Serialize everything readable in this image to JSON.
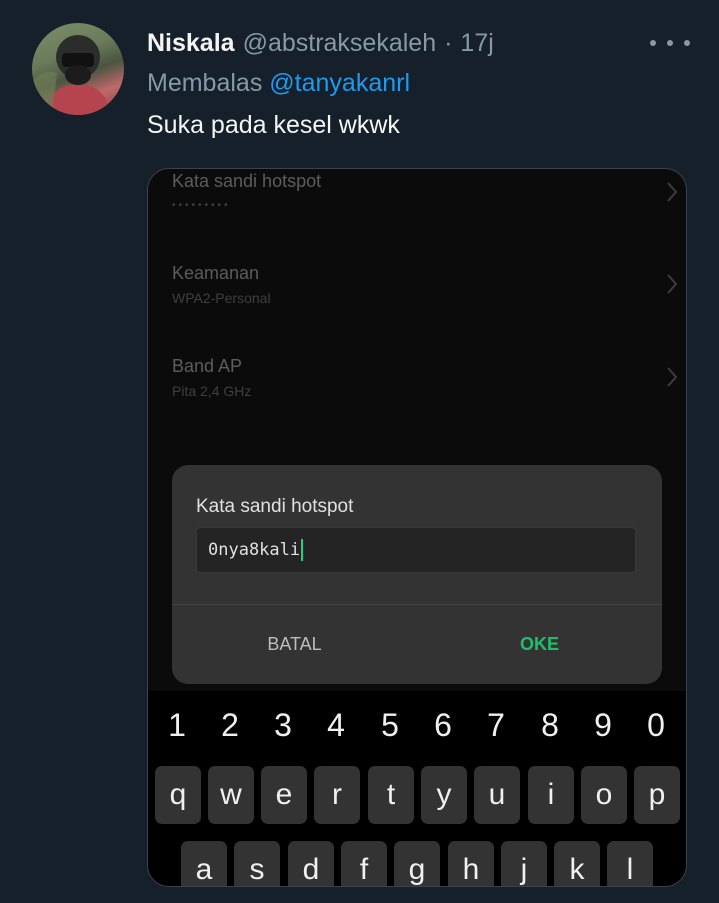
{
  "tweet": {
    "display_name": "Niskala",
    "handle": "@abstraksekaleh",
    "separator": "·",
    "time": "17j",
    "reply_prefix": "Membalas",
    "reply_to": "@tanyakanrl",
    "text": "Suka pada kesel wkwk",
    "more_icon": "more-horizontal-icon"
  },
  "screenshot": {
    "settings": [
      {
        "title": "Kata sandi hotspot",
        "sub": "•••••••••"
      },
      {
        "title": "Keamanan",
        "sub": "WPA2-Personal"
      },
      {
        "title": "Band AP",
        "sub": "Pita 2,4 GHz"
      }
    ],
    "chevron": "›",
    "dialog": {
      "title": "Kata sandi hotspot",
      "value": "0nya8kali",
      "cancel": "BATAL",
      "ok": "OKE"
    },
    "keyboard": {
      "numbers": [
        "1",
        "2",
        "3",
        "4",
        "5",
        "6",
        "7",
        "8",
        "9",
        "0"
      ],
      "row1": [
        "q",
        "w",
        "e",
        "r",
        "t",
        "y",
        "u",
        "i",
        "o",
        "p"
      ],
      "row2": [
        "a",
        "s",
        "d",
        "f",
        "g",
        "h",
        "j",
        "k",
        "l"
      ]
    }
  },
  "colors": {
    "background": "#15202b",
    "accent": "#1d9bf0",
    "ok_green": "#1fbf6a",
    "caret": "#1fd27a"
  }
}
